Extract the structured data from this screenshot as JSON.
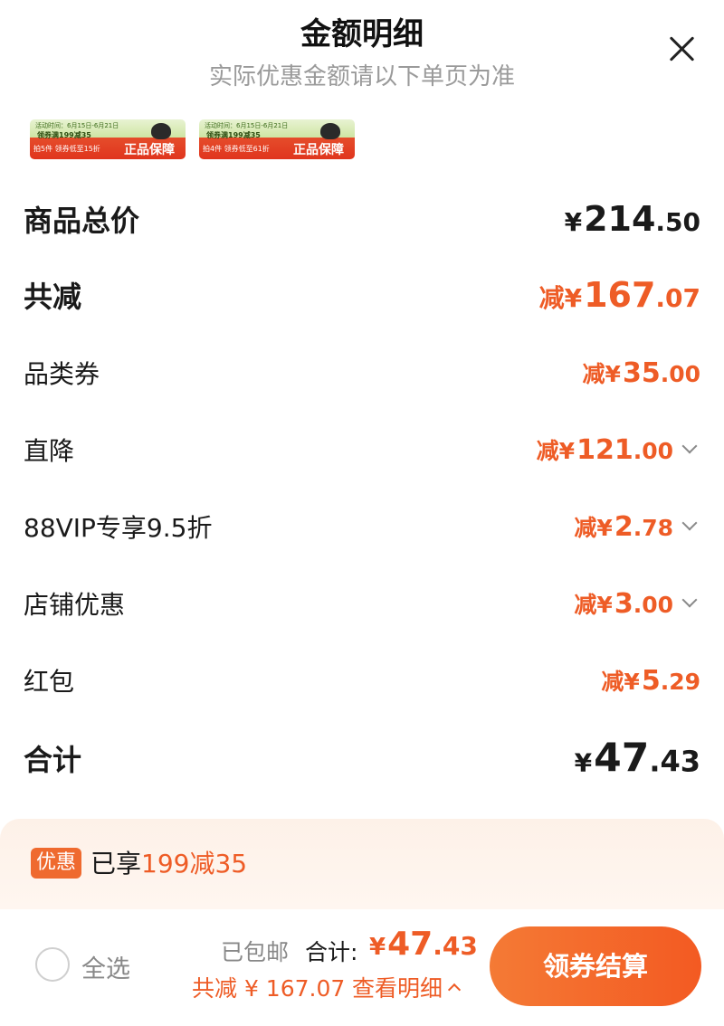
{
  "header": {
    "title": "金额明细",
    "subtitle": "实际优惠金额请以下单页为准"
  },
  "thumbnails": [
    {
      "line1": "活动时间：6月15日-6月21日",
      "line2": "领券满199减35",
      "line3": "拍5件 领券低至15折",
      "badge": "正品保障"
    },
    {
      "line1": "活动时间：6月15日-6月21日",
      "line2": "领券满199减35",
      "line3": "拍4件 领券低至61折",
      "badge": "正品保障"
    }
  ],
  "rows": {
    "subtotal": {
      "label": "商品总价",
      "prefix": "¥",
      "int": "214",
      "dec": ".50"
    },
    "total_reduce": {
      "label": "共减",
      "prefix": "减¥",
      "int": "167",
      "dec": ".07"
    },
    "category_coupon": {
      "label": "品类券",
      "prefix": "减¥",
      "int": "35",
      "dec": ".00"
    },
    "direct_drop": {
      "label": "直降",
      "prefix": "减¥",
      "int": "121",
      "dec": ".00"
    },
    "vip": {
      "label": "88VIP专享9.5折",
      "prefix": "减¥",
      "int": "2",
      "dec": ".78"
    },
    "store": {
      "label": "店铺优惠",
      "prefix": "减¥",
      "int": "3",
      "dec": ".00"
    },
    "red_packet": {
      "label": "红包",
      "prefix": "减¥",
      "int": "5",
      "dec": ".29"
    },
    "total": {
      "label": "合计",
      "prefix": "¥",
      "int": "47",
      "dec": ".43"
    }
  },
  "promo": {
    "tag": "优惠",
    "text_prefix": "已享",
    "text_highlight": "199减35"
  },
  "bottom": {
    "select_all": "全选",
    "shipping": "已包邮",
    "total_label": "合计:",
    "total_prefix": "¥",
    "total_int": "47",
    "total_dec": ".43",
    "saved": "共减 ¥ 167.07",
    "detail": "查看明细",
    "checkout": "领券结算"
  },
  "colors": {
    "accent": "#ee5c26",
    "checkout_start": "#f47a35",
    "checkout_end": "#f35a22"
  }
}
